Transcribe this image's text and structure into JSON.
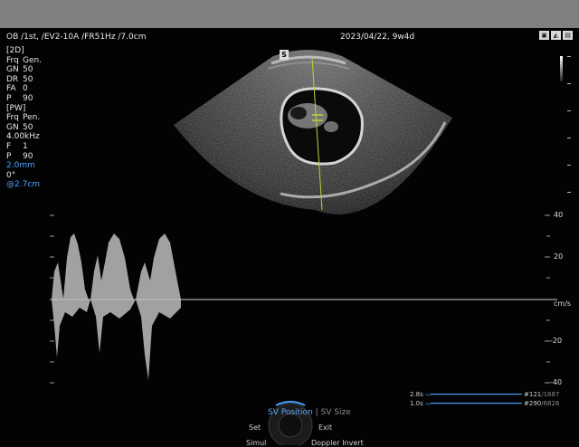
{
  "header": {
    "left": "OB /1st, /EV2-10A /FR51Hz /7.0cm",
    "date": "2023/04/22, 9w4d",
    "probe_badge": "S"
  },
  "params_2d": {
    "title": "[2D]",
    "rows": [
      {
        "k": "Frq",
        "v": "Gen."
      },
      {
        "k": "GN",
        "v": "50"
      },
      {
        "k": "DR",
        "v": "50"
      },
      {
        "k": "FA",
        "v": "0"
      },
      {
        "k": "P",
        "v": "90"
      }
    ]
  },
  "params_pw": {
    "title": "[PW]",
    "rows": [
      {
        "k": "Frq",
        "v": "Pen."
      },
      {
        "k": "GN",
        "v": "50"
      },
      {
        "k": "",
        "v": "4.00kHz"
      },
      {
        "k": "F",
        "v": "1"
      },
      {
        "k": "P",
        "v": "90"
      }
    ],
    "gate": "2.0mm",
    "angle": "0°",
    "depth": "@2.7cm"
  },
  "doppler_axis": {
    "labels": [
      "40",
      "20",
      "cm/s",
      "-20",
      "-40"
    ],
    "unit": "cm/s"
  },
  "cine": {
    "row1": {
      "time": "2.8s",
      "frame": "#121",
      "total": "/1687"
    },
    "row2": {
      "time": "1.0s",
      "frame": "#290",
      "total": "/6826"
    }
  },
  "menu": {
    "sv_position": "SV Position",
    "separator": "|",
    "sv_size": "SV Size",
    "set": "Set",
    "exit": "Exit",
    "simul": "Simul",
    "doppler_invert": "Doppler Invert"
  },
  "colors": {
    "accent_blue": "#4aa3ff",
    "cursor_line": "#b8d43a"
  }
}
